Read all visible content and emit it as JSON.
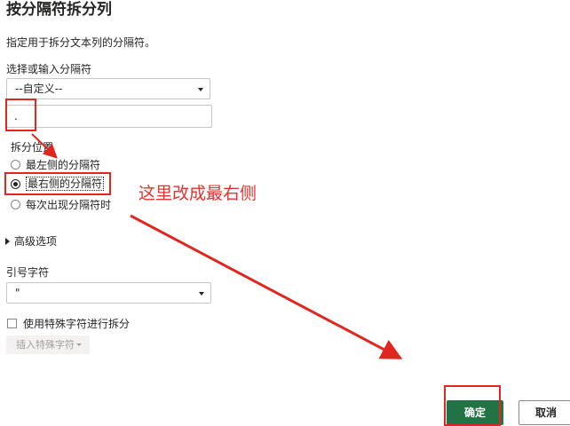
{
  "dialog": {
    "title": "按分隔符拆分列",
    "description": "指定用于拆分文本列的分隔符。"
  },
  "delimiter": {
    "label": "选择或输入分隔符",
    "selected": "--自定义--",
    "custom_value": "."
  },
  "split_position": {
    "label": "拆分位置",
    "options": [
      "最左侧的分隔符",
      "最右侧的分隔符",
      "每次出现分隔符时"
    ],
    "selected_index": 1
  },
  "advanced": {
    "label": "高级选项"
  },
  "quote": {
    "label": "引号字符",
    "selected": "\""
  },
  "special_chars": {
    "checkbox_label": "使用特殊字符进行拆分",
    "checked": false,
    "insert_button": "插入特殊字符"
  },
  "buttons": {
    "ok": "确定",
    "cancel": "取消"
  },
  "annotation": {
    "text": "这里改成最右侧",
    "color": "#e0261e"
  },
  "colors": {
    "primary_button": "#217346",
    "annotation_red": "#e0261e"
  }
}
